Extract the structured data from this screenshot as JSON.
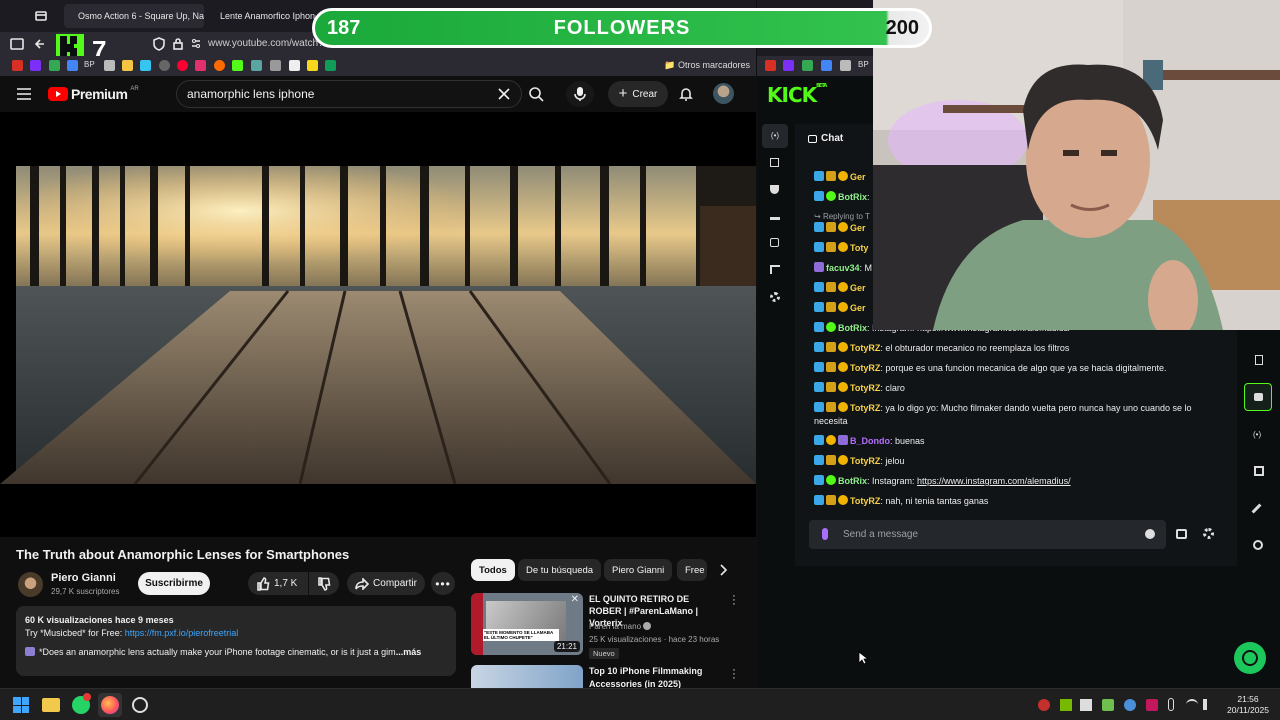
{
  "browser": {
    "tabs": [
      {
        "label": "Osmo Action 6 - Square Up, Na"
      },
      {
        "label": "Lente Anamorfico Iphone"
      }
    ],
    "url": "www.youtube.com/watch?",
    "other_bookmarks": "Otros marcadores"
  },
  "overlay": {
    "count": "187",
    "label": "FOLLOWERS",
    "goal": "200",
    "current": 187,
    "target": 200
  },
  "youtube": {
    "logo": "Premium",
    "region": "AR",
    "search_value": "anamorphic lens iphone",
    "crear_label": "Crear",
    "video_title": "The Truth about Anamorphic Lenses for Smartphones",
    "channel_name": "Piero Gianni",
    "subscribers": "29,7 K suscriptores",
    "subscribe_label": "Suscribirme",
    "like_count": "1,7 K",
    "share_label": "Compartir",
    "desc_stats": "60 K visualizaciones  hace 9 meses",
    "desc_line1_prefix": "Try *Musicbed* for Free: ",
    "desc_link": "https://fm.pxf.io/pierofreetrial",
    "desc_line2": "*Does an anamorphic lens actually make your iPhone footage cinematic, or is it just a gim",
    "desc_more": "...más",
    "chips": [
      "Todos",
      "De tu búsqueda",
      "Piero Gianni",
      "Free"
    ],
    "recommendations": [
      {
        "title": "EL QUINTO RETIRO DE ROBER | #ParenLaMano | Vorterix",
        "channel": "Paren la mano",
        "meta": "25 K visualizaciones · hace 23 horas",
        "badge": "Nuevo",
        "duration": "21:21",
        "thumb_caption": "\"ESTE MOMENTO SE LLAMABA EL ÚLTIMO CHUPETE\""
      },
      {
        "title": "Top 10 iPhone Filmmaking Accessories (in 2025)"
      }
    ]
  },
  "kick": {
    "logo": "KICK",
    "logo_sup": "BETA",
    "chat_label": "Chat",
    "input_placeholder": "Send a message",
    "messages": [
      {
        "user": "BotRix",
        "text": ""
      },
      {
        "user": "",
        "text": "Replying to T"
      },
      {
        "user": "Ger",
        "text": ""
      },
      {
        "user": "Toty",
        "text": ""
      },
      {
        "user": "facuv34",
        "text": ""
      },
      {
        "user": "Ger",
        "text": ""
      },
      {
        "user": "Ger",
        "text": ""
      },
      {
        "user": "BotRix",
        "text": "Instagram: https://www.instagram.com/alemadius/"
      },
      {
        "user": "TotyRZ",
        "text": "el obturador mecanico no reemplaza los filtros"
      },
      {
        "user": "TotyRZ",
        "text": "porque es una funcion mecanica de algo que ya se hacia digitalmente."
      },
      {
        "user": "TotyRZ",
        "text": "claro"
      },
      {
        "user": "TotyRZ",
        "text": "ya lo digo yo: Mucho filmaker dando vuelta pero nunca hay uno cuando se lo necesita"
      },
      {
        "user": "B_Dondo",
        "text": "buenas"
      },
      {
        "user": "TotyRZ",
        "text": "jelou"
      },
      {
        "user": "BotRix",
        "text": "Instagram: ",
        "link": "https://www.instagram.com/alemadius/"
      },
      {
        "user": "TotyRZ",
        "text": "nah, ni tenia tantas ganas"
      }
    ]
  },
  "taskbar": {
    "time": "21:56",
    "date": "20/11/2025"
  },
  "colors": {
    "kick_green": "#53fc18",
    "yt_red": "#ff0000",
    "followers_green": "#32c24d"
  }
}
